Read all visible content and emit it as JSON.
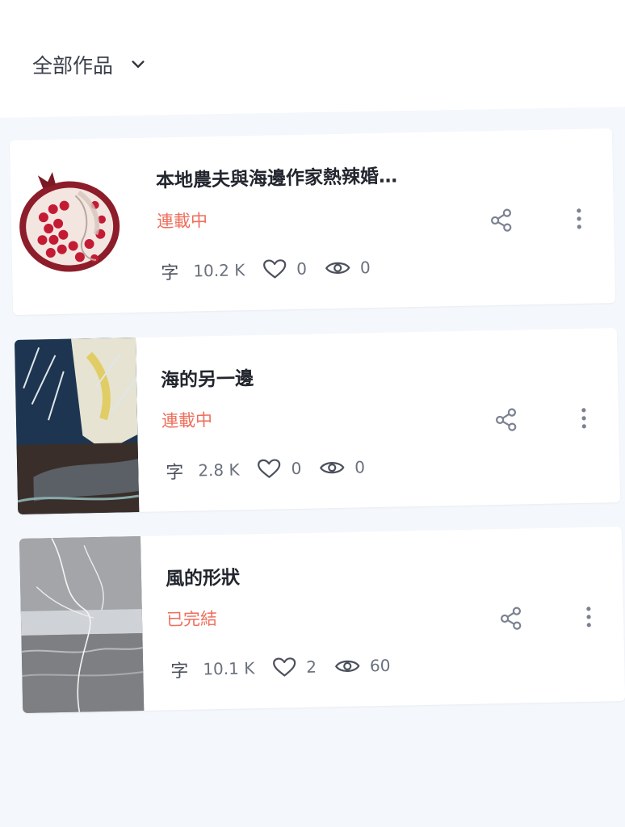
{
  "header": {
    "filter_label": "全部作品"
  },
  "works": [
    {
      "title": "本地農夫與海邊作家熱辣婚…",
      "status": "連載中",
      "word_icon": "字",
      "words": "10.2 K",
      "likes": "0",
      "views": "0",
      "cover": "pomegranate-cover"
    },
    {
      "title": "海的另一邊",
      "status": "連載中",
      "word_icon": "字",
      "words": "2.8 K",
      "likes": "0",
      "views": "0",
      "cover": "mermaid-cover"
    },
    {
      "title": "風的形狀",
      "status": "已完結",
      "word_icon": "字",
      "words": "10.1 K",
      "likes": "2",
      "views": "60",
      "cover": "seascape-sketch-cover"
    }
  ],
  "colors": {
    "status": "#ee6f5c",
    "title": "#23262e",
    "meta": "#6b717d",
    "icon": "#7b8190",
    "background": "#f4f7fb"
  }
}
